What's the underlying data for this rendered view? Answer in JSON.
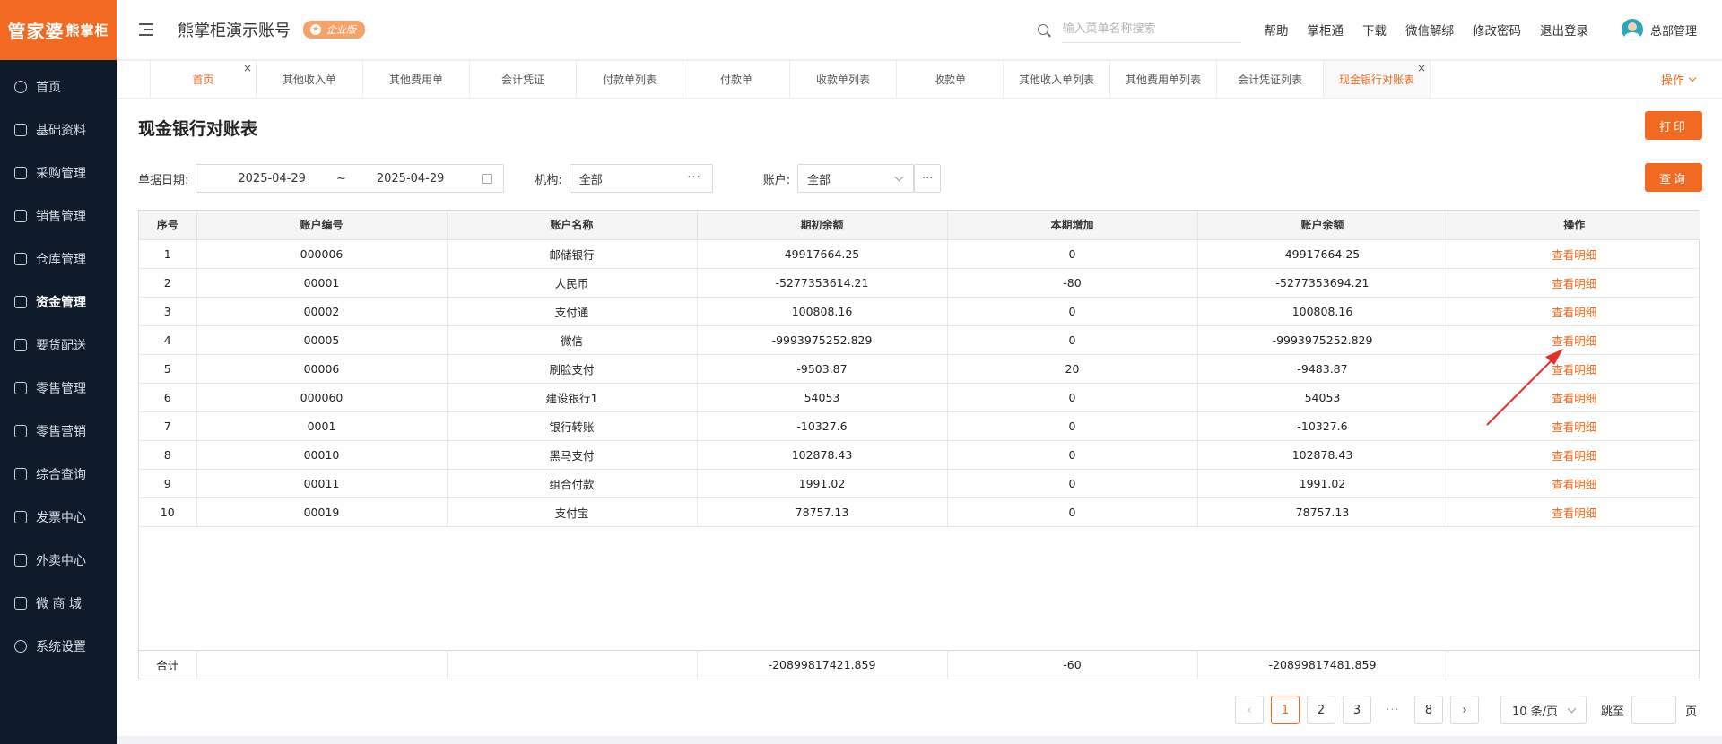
{
  "logo": {
    "main": "管家婆",
    "sub": "熊掌柜"
  },
  "sidebar": {
    "items": [
      {
        "label": "首页",
        "icon": "globe-icon"
      },
      {
        "label": "基础资料",
        "icon": "home-icon"
      },
      {
        "label": "采购管理",
        "icon": "cart-icon"
      },
      {
        "label": "销售管理",
        "icon": "keyboard-icon"
      },
      {
        "label": "仓库管理",
        "icon": "warehouse-icon"
      },
      {
        "label": "资金管理",
        "icon": "wallet-icon",
        "active": true
      },
      {
        "label": "要货配送",
        "icon": "list-icon"
      },
      {
        "label": "零售管理",
        "icon": "chart-icon"
      },
      {
        "label": "零售营销",
        "icon": "gift-icon"
      },
      {
        "label": "综合查询",
        "icon": "bar-chart-icon"
      },
      {
        "label": "发票中心",
        "icon": "trend-icon"
      },
      {
        "label": "外卖中心",
        "icon": "delivery-icon"
      },
      {
        "label": "微 商 城",
        "icon": "shop-icon"
      },
      {
        "label": "系统设置",
        "icon": "gear-icon"
      }
    ]
  },
  "header": {
    "title": "熊掌柜演示账号",
    "badge": "企业版",
    "search_placeholder": "输入菜单名称搜索",
    "links": [
      "帮助",
      "掌柜通",
      "下载",
      "微信解绑",
      "修改密码",
      "退出登录"
    ],
    "user": "总部管理"
  },
  "tabs": {
    "items": [
      "首页",
      "其他收入单",
      "其他费用单",
      "会计凭证",
      "付款单列表",
      "付款单",
      "收款单列表",
      "收款单",
      "其他收入单列表",
      "其他费用单列表",
      "会计凭证列表",
      "现金银行对账表"
    ],
    "ops_label": "操作"
  },
  "page": {
    "title": "现金银行对账表",
    "print_label": "打印",
    "query_label": "查询"
  },
  "filters": {
    "date_label": "单据日期:",
    "date_from": "2025-04-29",
    "date_sep": "~",
    "date_to": "2025-04-29",
    "org_label": "机构:",
    "org_value": "全部",
    "account_label": "账户:",
    "account_value": "全部",
    "more": "···"
  },
  "table": {
    "headers": [
      "序号",
      "账户编号",
      "账户名称",
      "期初余额",
      "本期增加",
      "账户余额",
      "操作"
    ],
    "action_label": "查看明细",
    "rows": [
      [
        "1",
        "000006",
        "邮储银行",
        "49917664.25",
        "0",
        "49917664.25"
      ],
      [
        "2",
        "00001",
        "人民币",
        "-5277353614.21",
        "-80",
        "-5277353694.21"
      ],
      [
        "3",
        "00002",
        "支付通",
        "100808.16",
        "0",
        "100808.16"
      ],
      [
        "4",
        "00005",
        "微信",
        "-9993975252.829",
        "0",
        "-9993975252.829"
      ],
      [
        "5",
        "00006",
        "刷脸支付",
        "-9503.87",
        "20",
        "-9483.87"
      ],
      [
        "6",
        "000060",
        "建设银行1",
        "54053",
        "0",
        "54053"
      ],
      [
        "7",
        "0001",
        "银行转账",
        "-10327.6",
        "0",
        "-10327.6"
      ],
      [
        "8",
        "00010",
        "黑马支付",
        "102878.43",
        "0",
        "102878.43"
      ],
      [
        "9",
        "00011",
        "组合付款",
        "1991.02",
        "0",
        "1991.02"
      ],
      [
        "10",
        "00019",
        "支付宝",
        "78757.13",
        "0",
        "78757.13"
      ]
    ],
    "total": {
      "label": "合计",
      "opening": "-20899817421.859",
      "increase": "-60",
      "balance": "-20899817481.859"
    }
  },
  "pagination": {
    "pages": [
      "1",
      "2",
      "3",
      "8"
    ],
    "ellipsis": "···",
    "prev": "‹",
    "next": "›",
    "page_size": "10 条/页",
    "jump_label": "跳至",
    "page_unit": "页"
  },
  "colors": {
    "accent": "#f26a21",
    "sidebar": "#0f1b2a",
    "annotation_arrow": "#e8302a"
  }
}
